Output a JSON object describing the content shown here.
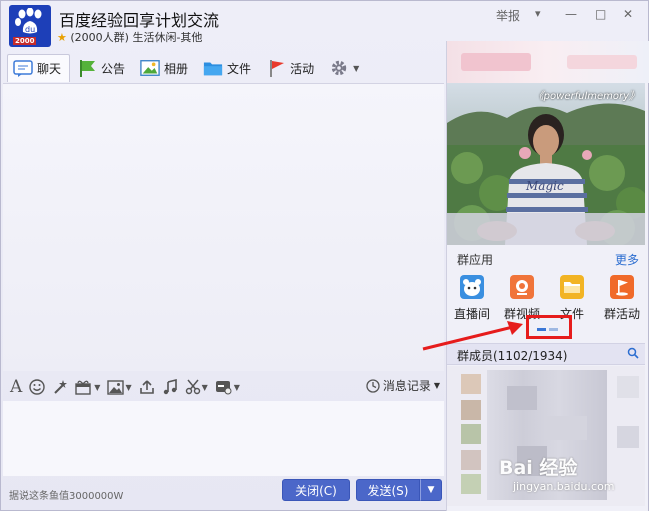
{
  "window": {
    "title": "百度经验回享计划交流",
    "subtitle_members": "(2000人群)",
    "subtitle_category": "生活休闲-其他",
    "report_label": "举报",
    "logo_year": "2000",
    "controls": [
      "▾",
      "—",
      "□",
      "✕"
    ]
  },
  "tabs": [
    {
      "label": "聊天",
      "icon": "chat-icon"
    },
    {
      "label": "公告",
      "icon": "flag-icon"
    },
    {
      "label": "相册",
      "icon": "photo-album-icon"
    },
    {
      "label": "文件",
      "icon": "folder-icon"
    },
    {
      "label": "活动",
      "icon": "event-flag-icon"
    }
  ],
  "toolbar": {
    "history_label": "消息记录"
  },
  "input": {
    "hint": "据说这条鱼值3000000W"
  },
  "actions": {
    "close_label": "关闭(C)",
    "send_label": "发送(S)"
  },
  "side": {
    "photo_caption": "《powerfulmemory》",
    "photo_shirt_text": "Magic",
    "apps_title": "群应用",
    "apps_more": "更多",
    "apps": [
      {
        "label": "直播间",
        "icon": "live-icon",
        "color": "#3a8fe0"
      },
      {
        "label": "群视频",
        "icon": "video-icon",
        "color": "#f0743a"
      },
      {
        "label": "文件",
        "icon": "folder-icon",
        "color": "#f2b424"
      },
      {
        "label": "群活动",
        "icon": "activity-icon",
        "color": "#f06a2a"
      }
    ],
    "members_title": "群成员(1102/1934)"
  },
  "watermark": {
    "main": "Bai 经验",
    "sub": "jingyan.baidu.com"
  }
}
